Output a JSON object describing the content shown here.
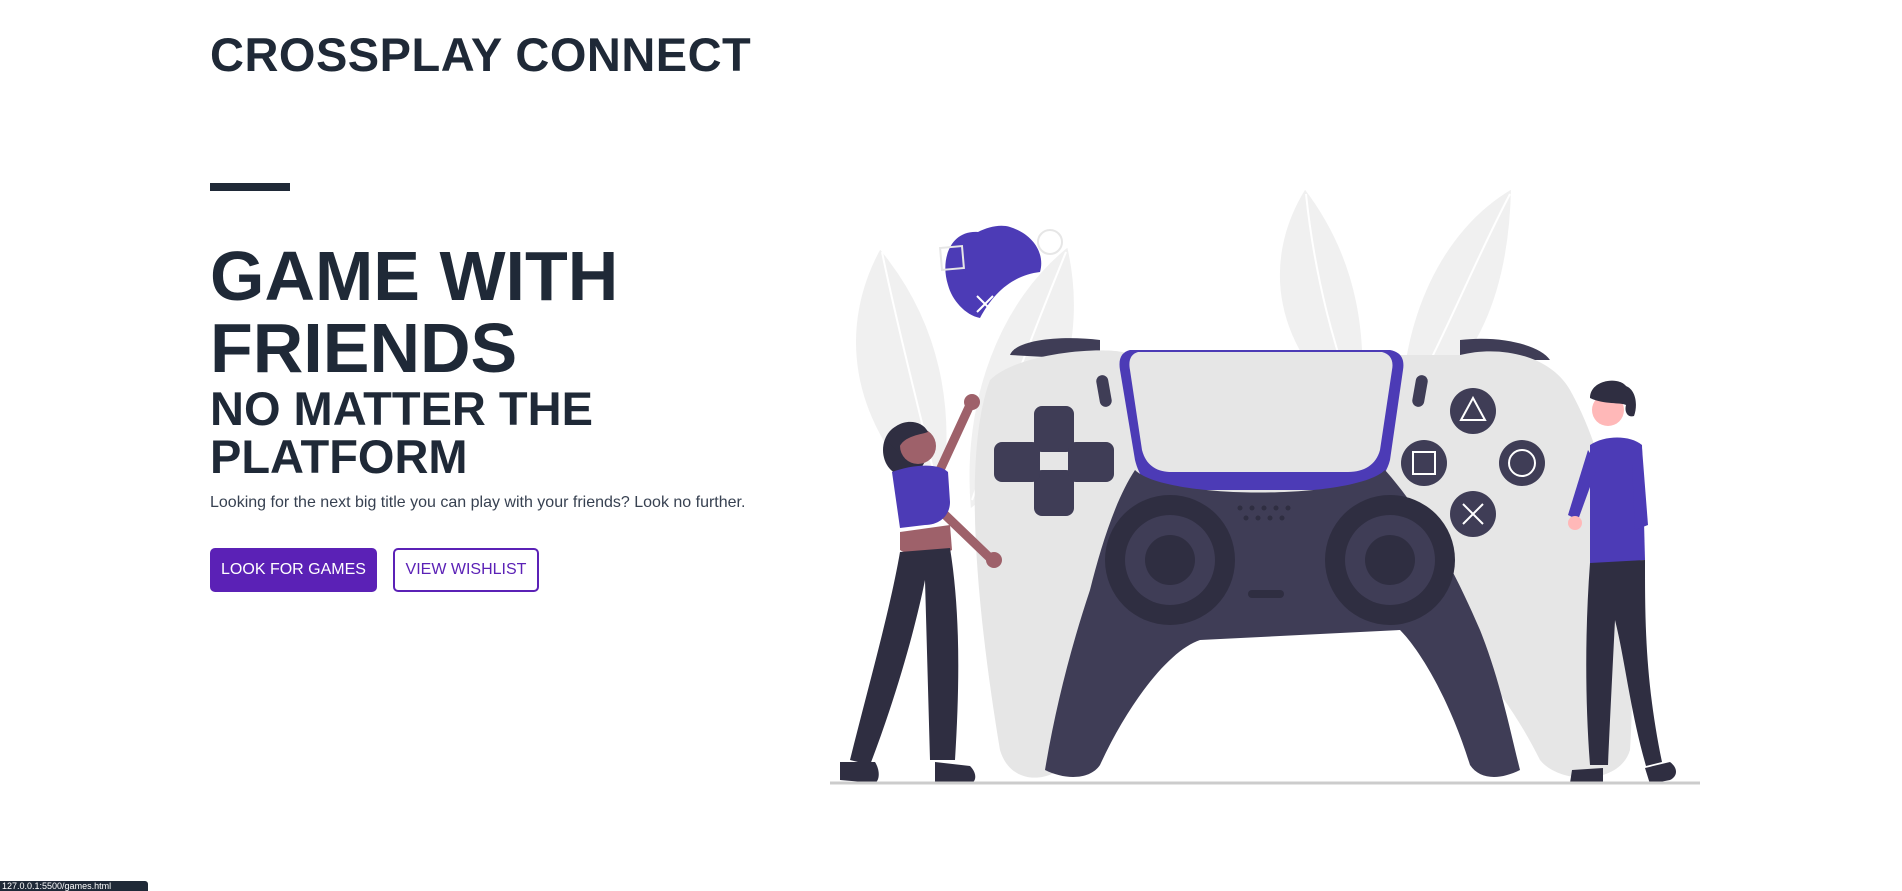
{
  "header": {
    "brand": "CROSSPLAY CONNECT"
  },
  "hero": {
    "title": "GAME WITH FRIENDS",
    "subtitle": "NO MATTER THE PLATFORM",
    "description": "Looking for the next big title you can play with your friends? Look no further.",
    "primary_button": "LOOK FOR GAMES",
    "secondary_button": "VIEW WISHLIST"
  },
  "status_bar": {
    "url": "127.0.0.1:5500/games.html"
  },
  "colors": {
    "text_dark": "#1f2937",
    "accent_purple": "#5b21b6",
    "illustration_purple": "#4c3bb6",
    "controller_dark": "#3f3d56",
    "controller_light": "#e6e6e6",
    "leaf_gray": "#f0f0f0"
  },
  "icons": {
    "illustration": "gamers-with-giant-controller-illustration"
  }
}
